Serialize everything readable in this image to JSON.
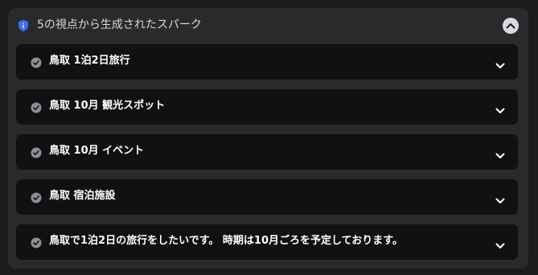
{
  "header": {
    "title": "5の視点から生成されたスパーク",
    "shield_icon": "shield-icon",
    "collapse_icon": "chevron-up-icon"
  },
  "items": [
    {
      "label": "鳥取 1泊2日旅行"
    },
    {
      "label": "鳥取 10月 観光スポット"
    },
    {
      "label": "鳥取 10月 イベント"
    },
    {
      "label": "鳥取 宿泊施設"
    },
    {
      "label": "鳥取で1泊2日の旅行をしたいです。 時期は10月ごろを予定しております。"
    }
  ],
  "colors": {
    "background": "#1c1c1e",
    "panel": "#2a2a2d",
    "item": "#111113",
    "shield": "#3b6df0",
    "check": "#8e8e93"
  }
}
